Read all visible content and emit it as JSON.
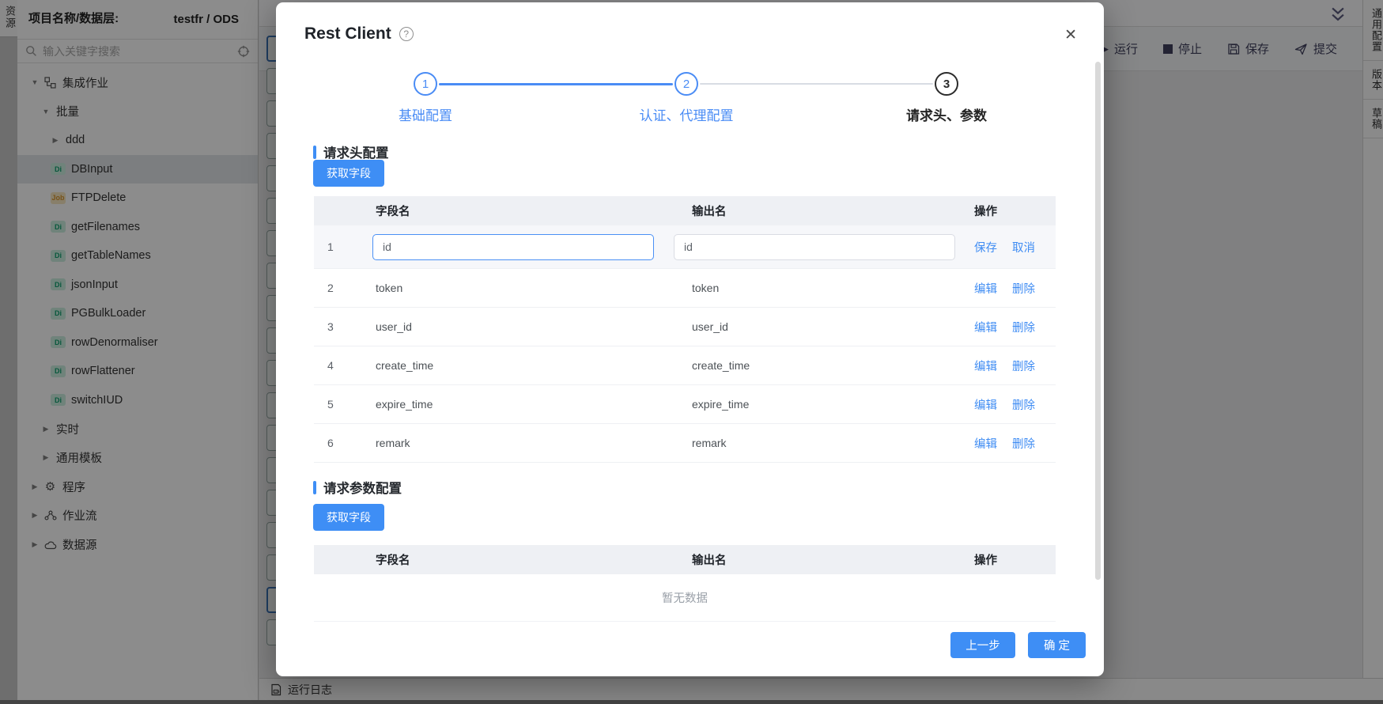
{
  "colors": {
    "accent": "#3e8ef5",
    "link": "#3f8cf3",
    "step_done": "#4a8cf5",
    "step_active": "#2b2b2b",
    "overlay": "rgba(0,0,0,0.45)"
  },
  "icons": {
    "close": "✕",
    "help": "?",
    "caret_down": "▼",
    "caret_right": "▶",
    "gear": "⚙",
    "play": "▶"
  },
  "left_rail": {
    "tab": "资源"
  },
  "sidebar": {
    "project_label": "项目名称/数据层:",
    "project_value": "testfr / ODS",
    "search_placeholder": "输入关键字搜索",
    "badges": {
      "di": "Di",
      "job": "Job"
    },
    "tree": [
      {
        "label": "集成作业"
      },
      {
        "label": "批量"
      },
      {
        "label": "ddd"
      },
      {
        "label": "DBInput",
        "badge": "Di",
        "selected": true
      },
      {
        "label": "FTPDelete",
        "badge": "Job"
      },
      {
        "label": "getFilenames",
        "badge": "Di"
      },
      {
        "label": "getTableNames",
        "badge": "Di"
      },
      {
        "label": "jsonInput",
        "badge": "Di"
      },
      {
        "label": "PGBulkLoader",
        "badge": "Di"
      },
      {
        "label": "rowDenormaliser",
        "badge": "Di"
      },
      {
        "label": "rowFlattener",
        "badge": "Di"
      },
      {
        "label": "switchIUD",
        "badge": "Di"
      },
      {
        "label": "实时"
      },
      {
        "label": "通用模板"
      },
      {
        "label": "程序"
      },
      {
        "label": "作业流"
      },
      {
        "label": "数据源"
      }
    ]
  },
  "canvas": {
    "toolbar": {
      "run": "运行",
      "stop": "停止",
      "save": "保存",
      "submit": "提交"
    },
    "right_tabs": [
      "通用配置",
      "版本",
      "草稿"
    ],
    "bottom_bar": "运行日志",
    "palette": {
      "count": 19,
      "highlighted": [
        0,
        17
      ]
    }
  },
  "modal": {
    "title": "Rest Client",
    "steps": [
      {
        "num": "1",
        "label": "基础配置",
        "state": "done"
      },
      {
        "num": "2",
        "label": "认证、代理配置",
        "state": "done"
      },
      {
        "num": "3",
        "label": "请求头、参数",
        "state": "active"
      }
    ],
    "header_section": {
      "title": "请求头配置",
      "button": "获取字段"
    },
    "param_section": {
      "title": "请求参数配置",
      "button": "获取字段",
      "empty": "暂无数据"
    },
    "columns": {
      "field": "字段名",
      "output": "输出名",
      "action": "操作"
    },
    "actions": {
      "save": "保存",
      "cancel": "取消",
      "edit": "编辑",
      "delete": "删除"
    },
    "header_rows": [
      {
        "no": "1",
        "field": "id",
        "output": "id",
        "editing": true
      },
      {
        "no": "2",
        "field": "token",
        "output": "token"
      },
      {
        "no": "3",
        "field": "user_id",
        "output": "user_id"
      },
      {
        "no": "4",
        "field": "create_time",
        "output": "create_time"
      },
      {
        "no": "5",
        "field": "expire_time",
        "output": "expire_time"
      },
      {
        "no": "6",
        "field": "remark",
        "output": "remark"
      }
    ],
    "footer": {
      "prev": "上一步",
      "ok": "确 定"
    }
  }
}
